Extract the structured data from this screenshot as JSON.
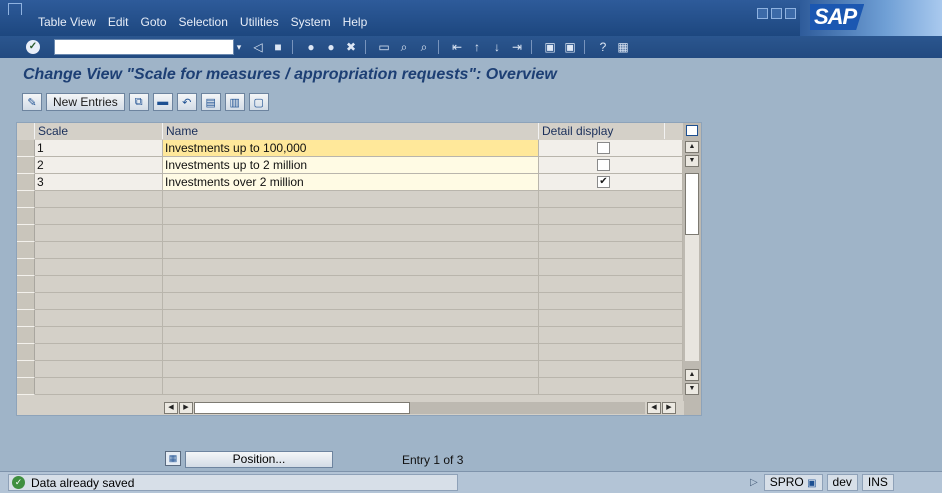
{
  "menubar": {
    "items": [
      "Table View",
      "Edit",
      "Goto",
      "Selection",
      "Utilities",
      "System",
      "Help"
    ],
    "logo": "SAP"
  },
  "toolbar": {
    "icons": [
      "save-icon",
      "back-icon",
      "exit-icon",
      "cancel-icon",
      "print-icon",
      "find-icon",
      "find-next-icon",
      "first-page-icon",
      "prev-page-icon",
      "next-page-icon",
      "last-page-icon",
      "new-session-icon",
      "shortcut-icon",
      "help-icon",
      "layout-icon"
    ]
  },
  "title": "Change View \"Scale for measures / appropriation requests\": Overview",
  "appbar": {
    "new_entries": "New Entries"
  },
  "table": {
    "columns": [
      "Scale",
      "Name",
      "Detail display"
    ],
    "rows": [
      {
        "scale": "1",
        "name": "Investments up to 100,000",
        "detail": false
      },
      {
        "scale": "2",
        "name": "Investments up to 2 million",
        "detail": false
      },
      {
        "scale": "3",
        "name": "Investments over 2 million",
        "detail": true
      }
    ],
    "checkmark": "✔"
  },
  "footer": {
    "position_label": "Position...",
    "entry_text": "Entry 1 of 3"
  },
  "status": {
    "message": "Data already saved",
    "transaction": "SPRO",
    "system": "dev",
    "mode": "INS"
  },
  "colors": {
    "menubar": "#2e5b9a",
    "background": "#9fb4c8",
    "title": "#1d3f74",
    "active_row": "#ffe89a"
  }
}
